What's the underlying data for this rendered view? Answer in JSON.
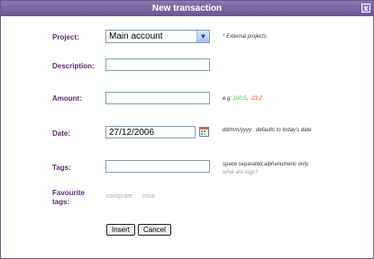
{
  "window": {
    "title": "New transaction",
    "close_label": "x"
  },
  "project": {
    "label": "Project:",
    "selected": "Main account",
    "hint": "* External projects"
  },
  "description": {
    "label": "Description:",
    "value": ""
  },
  "amount": {
    "label": "Amount:",
    "hint_prefix": "e.g:",
    "hint_positive": "100.5",
    "hint_sep": ",",
    "hint_negative": "-23.2",
    "value": ""
  },
  "date": {
    "label": "Date:",
    "value": "27/12/2006",
    "hint": "dd/mm/yyyy , defaults to today's date"
  },
  "tags": {
    "label": "Tags:",
    "value": "",
    "hint": "space separated,alphanumeric only.",
    "hint_link": "what are tags?"
  },
  "favourite_tags": {
    "label_line1": "Favourite",
    "label_line2": "tags:",
    "items": [
      "computer",
      "misc"
    ]
  },
  "buttons": {
    "insert": "Insert",
    "cancel": "Cancel"
  },
  "icons": {
    "dropdown": "chevron-down-icon",
    "calendar": "calendar-icon"
  }
}
